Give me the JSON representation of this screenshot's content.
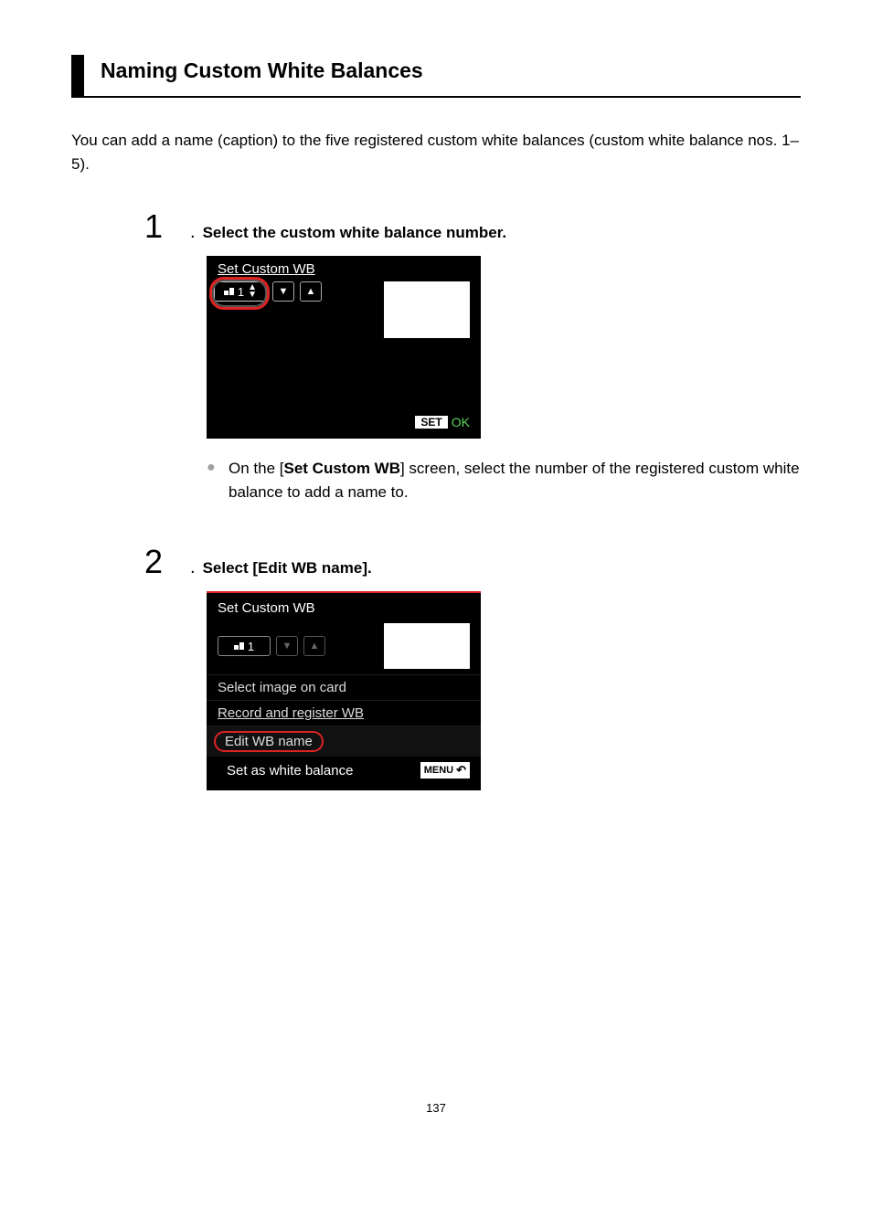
{
  "heading": "Naming Custom White Balances",
  "intro": "You can add a name (caption) to the five registered custom white balances (custom white balance nos. 1–5).",
  "steps": [
    {
      "num": "1",
      "title": "Select the custom white balance number.",
      "lcd": {
        "title": "Set Custom WB",
        "wb_number": "1",
        "set_label": "SET",
        "ok_label": "OK"
      },
      "bullet_pre": "On the [",
      "bullet_strong": "Set Custom WB",
      "bullet_post": "] screen, select the number of the registered custom white balance to add a name to."
    },
    {
      "num": "2",
      "title": "Select [Edit WB name].",
      "lcd": {
        "title": "Set Custom WB",
        "wb_number": "1",
        "items": [
          "Select image on card",
          "Record and register WB",
          "Edit WB name"
        ],
        "footer": "Set as white balance",
        "menu_label": "MENU"
      }
    }
  ],
  "page_number": "137"
}
